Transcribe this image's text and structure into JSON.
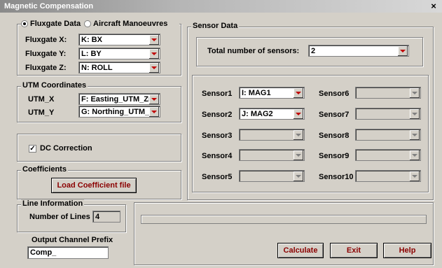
{
  "window": {
    "title": "Magnetic Compensation",
    "close": "×"
  },
  "fluxgate": {
    "radio_fluxgate": "Fluxgate Data",
    "radio_aircraft": "Aircraft Manoeuvres",
    "x_label": "Fluxgate X:",
    "x_value": "K: BX",
    "y_label": "Fluxgate Y:",
    "y_value": "L: BY",
    "z_label": "Fluxgate Z:",
    "z_value": "N: ROLL"
  },
  "utm": {
    "title": "UTM Coordinates",
    "x_label": "UTM_X",
    "x_value": "F: Easting_UTM_Zr",
    "y_label": "UTM_Y",
    "y_value": "G: Northing_UTM_Z"
  },
  "dc": {
    "label": "DC Correction",
    "checked": true
  },
  "coefficients": {
    "title": "Coefficients",
    "button": "Load Coefficient file"
  },
  "line_info": {
    "title": "Line Information",
    "label": "Number of Lines",
    "value": "4"
  },
  "output": {
    "label": "Output Channel Prefix",
    "value": "Comp_"
  },
  "sensor_data": {
    "title": "Sensor Data",
    "total_label": "Total number of sensors:",
    "total_value": "2",
    "sensors": [
      {
        "label": "Sensor1",
        "value": "I: MAG1"
      },
      {
        "label": "Sensor2",
        "value": "J: MAG2"
      },
      {
        "label": "Sensor3",
        "value": ""
      },
      {
        "label": "Sensor4",
        "value": ""
      },
      {
        "label": "Sensor5",
        "value": ""
      },
      {
        "label": "Sensor6",
        "value": ""
      },
      {
        "label": "Sensor7",
        "value": ""
      },
      {
        "label": "Sensor8",
        "value": ""
      },
      {
        "label": "Sensor9",
        "value": ""
      },
      {
        "label": "Sensor10",
        "value": ""
      }
    ]
  },
  "buttons": {
    "calculate": "Calculate",
    "exit": "Exit",
    "help": "Help"
  },
  "colors": {
    "button_text": "#8b0000",
    "dropdown_arrow": "#c00000",
    "face": "#d4d0c8"
  }
}
